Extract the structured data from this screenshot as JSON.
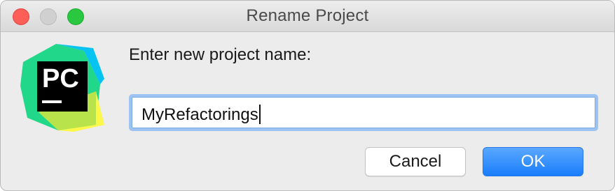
{
  "window": {
    "title": "Rename Project",
    "buttons": {
      "close": "close",
      "minimize": "minimize",
      "zoom": "zoom"
    }
  },
  "app_icon": {
    "name": "pycharm-icon",
    "text": "PC"
  },
  "dialog": {
    "prompt": "Enter new project name:",
    "input_value": "MyRefactorings",
    "cancel_label": "Cancel",
    "ok_label": "OK"
  },
  "colors": {
    "accent": "#1a7dfb",
    "focus_ring": "#9dc3f2",
    "close": "#fc5f57",
    "zoom": "#29c840"
  }
}
